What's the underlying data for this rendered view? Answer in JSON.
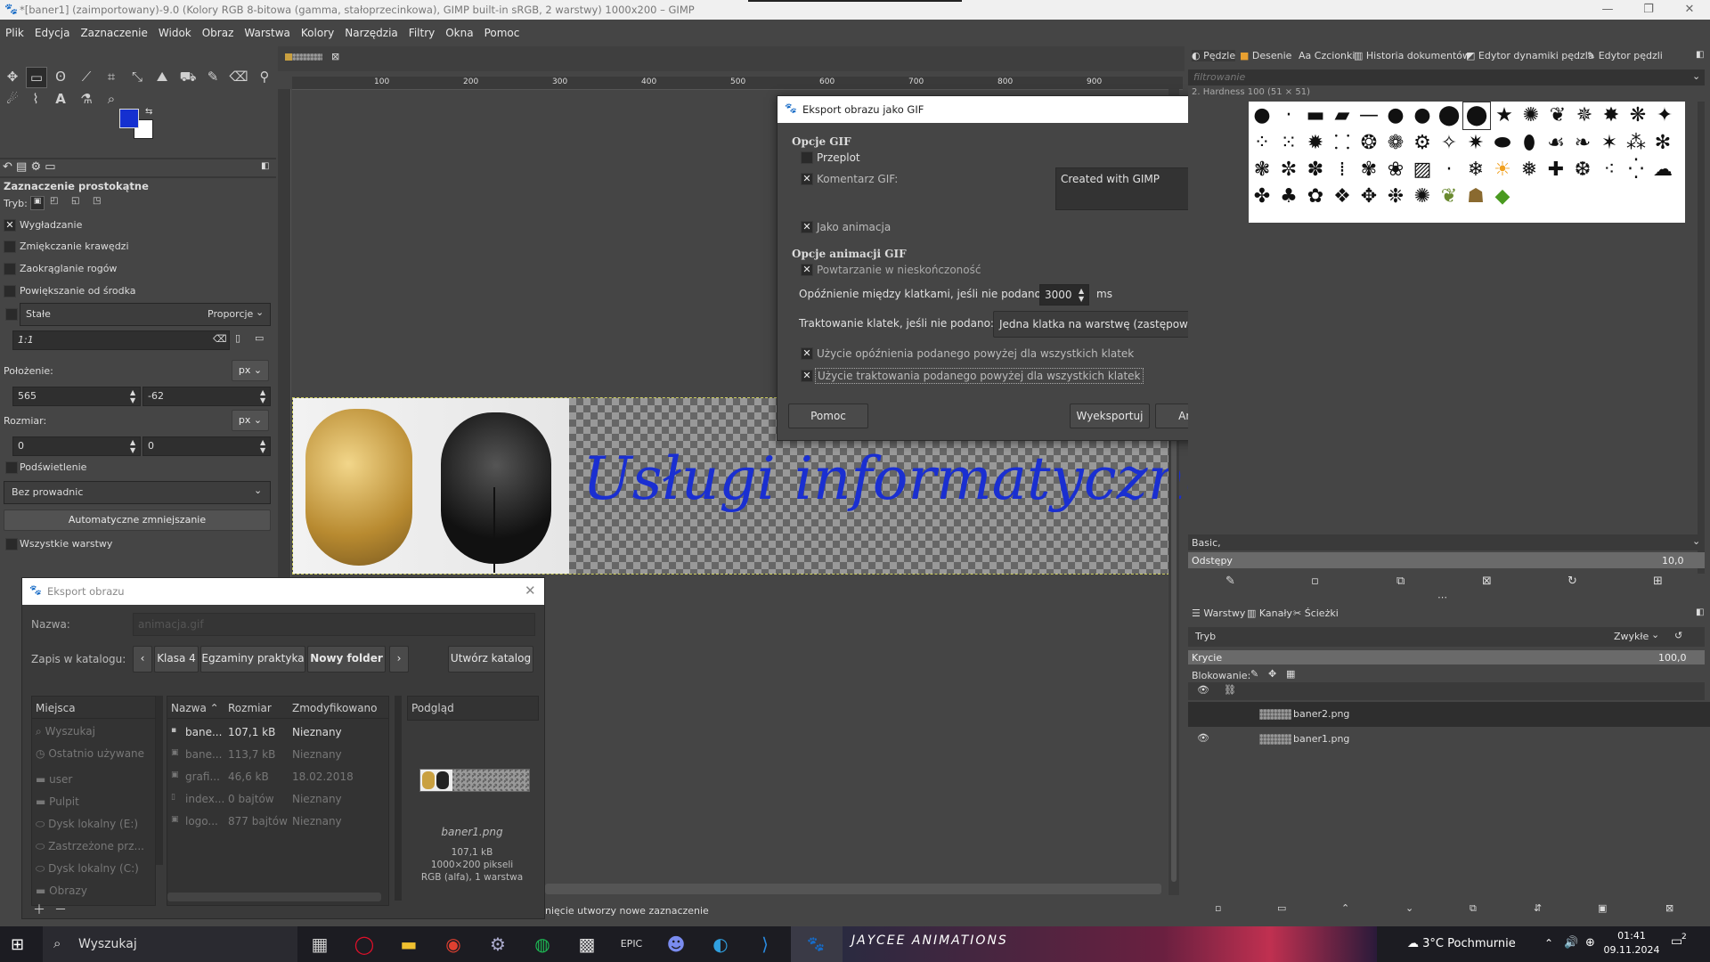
{
  "window": {
    "title": "*[baner1] (zaimportowany)-9.0 (Kolory RGB 8-bitowa (gamma, stałoprzecinkowa), GIMP built-in sRGB, 2 warstwy) 1000x200 – GIMP"
  },
  "menu": [
    "Plik",
    "Edycja",
    "Zaznaczenie",
    "Widok",
    "Obraz",
    "Warstwa",
    "Kolory",
    "Narzędzia",
    "Filtry",
    "Okna",
    "Pomoc"
  ],
  "tool_options": {
    "title": "Zaznaczenie prostokątne",
    "mode_label": "Tryb:",
    "antialias": "Wygładzanie",
    "feather": "Zmiękczanie krawędzi",
    "rounded": "Zaokrąglanie rogów",
    "expand": "Powiększanie od środka",
    "fixed": "Stałe",
    "fixed_option": "Proporcje",
    "ratio": "1:1",
    "position_label": "Położenie:",
    "position_unit": "px",
    "pos_x": "565",
    "pos_y": "-62",
    "size_label": "Rozmiar:",
    "size_unit": "px",
    "size_w": "0",
    "size_h": "0",
    "highlight": "Podświetlenie",
    "guides": "Bez prowadnic",
    "auto_shrink": "Automatyczne zmniejszanie",
    "all_layers": "Wszystkie warstwy"
  },
  "ruler": [
    "100",
    "200",
    "300",
    "400",
    "500",
    "600",
    "700",
    "800",
    "900"
  ],
  "canvas": {
    "banner_text": "Usługi informatyczne"
  },
  "statusbar": "nięcie utworzy nowe zaznaczenie",
  "gif_dialog": {
    "title": "Eksport obrazu jako GIF",
    "section1": "Opcje GIF",
    "interlace": "Przeplot",
    "comment_label": "Komentarz GIF:",
    "comment_value": "Created with GIMP",
    "as_animation": "Jako animacja",
    "section2": "Opcje animacji GIF",
    "loop": "Powtarzanie w nieskończoność",
    "delay_label": "Opóźnienie między klatkami, jeśli nie podano:",
    "delay_value": "3000",
    "delay_unit": "ms",
    "disposal_label": "Traktowanie klatek, jeśli nie podano:",
    "disposal_value": "Jedna klatka na warstwę (zastępowanie)",
    "use_delay": "Użycie opóźnienia podanego powyżej dla wszystkich klatek",
    "use_disposal": "Użycie traktowania podanego powyżej dla wszystkich klatek",
    "help_btn": "Pomoc",
    "export_btn": "Wyeksportuj",
    "cancel_btn": "Anuluj"
  },
  "export_dialog": {
    "title": "Eksport obrazu",
    "name_label": "Nazwa:",
    "name_value": "animacja.gif",
    "save_in_label": "Zapis w katalogu:",
    "crumbs": [
      "Klasa 4",
      "Egzaminy praktyka",
      "Nowy folder"
    ],
    "create_folder": "Utwórz katalog",
    "places_header": "Miejsca",
    "places": [
      "Wyszukaj",
      "Ostatnio używane",
      "user",
      "Pulpit",
      "Dysk lokalny (E:)",
      "Zastrzeżone prz...",
      "Dysk lokalny (C:)",
      "Obrazy"
    ],
    "col_name": "Nazwa",
    "col_size": "Rozmiar",
    "col_modified": "Zmodyfikowano",
    "files": [
      {
        "name": "bane...",
        "size": "107,1 kB",
        "modified": "Nieznany"
      },
      {
        "name": "bane...",
        "size": "113,7 kB",
        "modified": "Nieznany"
      },
      {
        "name": "grafi...",
        "size": "46,6 kB",
        "modified": "18.02.2018"
      },
      {
        "name": "index...",
        "size": "0 bajtów",
        "modified": "Nieznany"
      },
      {
        "name": "logo...",
        "size": "877 bajtów",
        "modified": "Nieznany"
      }
    ],
    "preview_header": "Podgląd",
    "preview_file": "baner1.png",
    "preview_size": "107,1 kB",
    "preview_dims": "1000×200 pikseli",
    "preview_mode": "RGB (alfa), 1 warstwa"
  },
  "right_tabs": [
    "Pędzle",
    "Desenie",
    "Czcionki",
    "Historia dokumentów",
    "Edytor dynamiki pędzla",
    "Edytor pędzli"
  ],
  "brushes": {
    "filter_placeholder": "filtrowanie",
    "current": "2. Hardness 100 (51 × 51)",
    "preset": "Basic,",
    "spacing_label": "Odstępy",
    "spacing_value": "10,0"
  },
  "layers_tabs": [
    "Warstwy",
    "Kanały",
    "Ścieżki"
  ],
  "layers": {
    "mode_label": "Tryb",
    "mode_value": "Zwykłe",
    "opacity_label": "Krycie",
    "opacity_value": "100,0",
    "lock_label": "Blokowanie:",
    "items": [
      "baner2.png",
      "baner1.png"
    ]
  },
  "taskbar": {
    "search": "Wyszukaj",
    "weather": "3°C  Pochmurnie",
    "time": "01:41",
    "date": "09.11.2024",
    "app_label": "JAYCEE ANIMATIONS",
    "notif_count": "2"
  },
  "colors": {
    "fg": "#1530d0",
    "accent": "#2a3fd1"
  }
}
